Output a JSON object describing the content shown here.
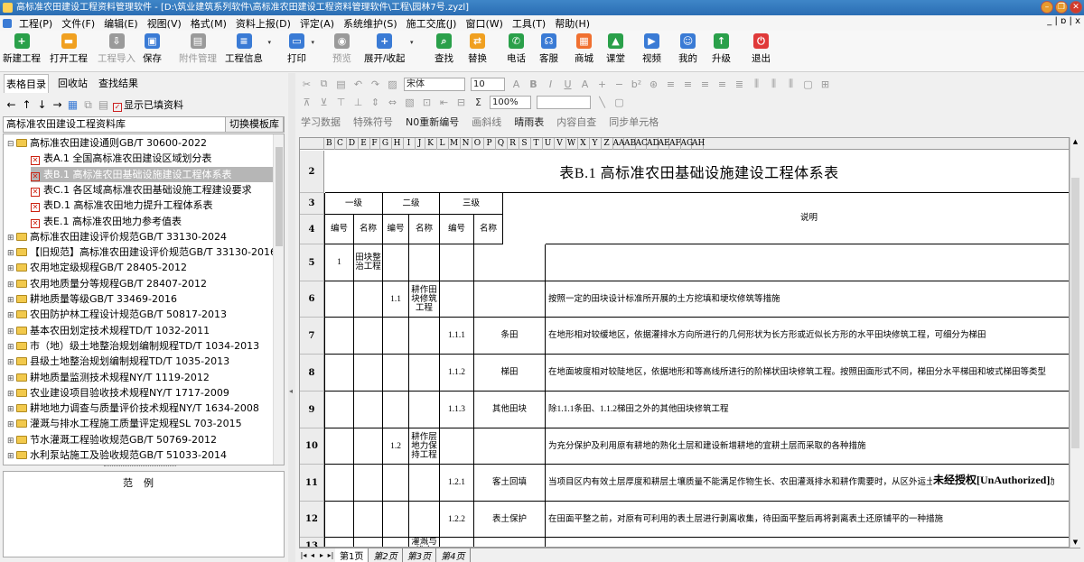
{
  "title": "高标准农田建设工程资料管理软件 - [D:\\筑业建筑系列软件\\高标准农田建设工程资料管理软件\\工程\\园林7号.zyzl]",
  "menu": [
    "工程(P)",
    "文件(F)",
    "编辑(E)",
    "视图(V)",
    "格式(M)",
    "资料上报(D)",
    "评定(A)",
    "系统维护(S)",
    "施工交底(J)",
    "窗口(W)",
    "工具(T)",
    "帮助(H)"
  ],
  "mdi_controls": "_ | ɒ | x",
  "toolbar": [
    {
      "label": "新建工程",
      "icon": "new-project-icon",
      "glyph": "+",
      "color": "#2aa04a",
      "disabled": false
    },
    {
      "label": "打开工程",
      "icon": "open-project-icon",
      "glyph": "▬",
      "color": "#f0a020",
      "disabled": false
    },
    {
      "label": "工程导入",
      "icon": "import-project-icon",
      "glyph": "⇩",
      "color": "#9a9a9a",
      "disabled": true
    },
    {
      "label": "保存",
      "icon": "save-icon",
      "glyph": "▣",
      "color": "#3a7bd5",
      "disabled": false
    },
    {
      "label": "附件管理",
      "icon": "attachment-icon",
      "glyph": "▤",
      "color": "#9a9a9a",
      "disabled": true
    },
    {
      "label": "工程信息",
      "icon": "project-info-icon",
      "glyph": "≡",
      "color": "#3a7bd5",
      "disabled": false
    },
    {
      "label": "打印",
      "icon": "print-icon",
      "glyph": "▭",
      "color": "#3a7bd5",
      "disabled": false
    },
    {
      "label": "预览",
      "icon": "preview-icon",
      "glyph": "◉",
      "color": "#9a9a9a",
      "disabled": true
    },
    {
      "label": "展开/收起",
      "icon": "expand-collapse-icon",
      "glyph": "+",
      "color": "#3a7bd5",
      "disabled": false
    },
    {
      "label": "查找",
      "icon": "find-icon",
      "glyph": "⌕",
      "color": "#2aa04a",
      "disabled": false
    },
    {
      "label": "替换",
      "icon": "replace-icon",
      "glyph": "⇄",
      "color": "#f0a020",
      "disabled": false
    },
    {
      "label": "电话",
      "icon": "phone-icon",
      "glyph": "✆",
      "color": "#2aa04a",
      "disabled": false
    },
    {
      "label": "客服",
      "icon": "customer-service-icon",
      "glyph": "☊",
      "color": "#3a7bd5",
      "disabled": false
    },
    {
      "label": "商城",
      "icon": "store-icon",
      "glyph": "▦",
      "color": "#f07030",
      "disabled": false
    },
    {
      "label": "课堂",
      "icon": "classroom-icon",
      "glyph": "▲",
      "color": "#2aa04a",
      "disabled": false
    },
    {
      "label": "视频",
      "icon": "video-icon",
      "glyph": "▶",
      "color": "#3a7bd5",
      "disabled": false
    },
    {
      "label": "我的",
      "icon": "user-icon",
      "glyph": "☺",
      "color": "#3a7bd5",
      "disabled": false
    },
    {
      "label": "升级",
      "icon": "upgrade-icon",
      "glyph": "↑",
      "color": "#2aa04a",
      "disabled": false
    },
    {
      "label": "退出",
      "icon": "exit-icon",
      "glyph": "⏻",
      "color": "#e03a3a",
      "disabled": false
    }
  ],
  "left_tabs": [
    "表格目录",
    "回收站",
    "查找结果"
  ],
  "show_filled_label": "显示已填资料",
  "library_name": "高标准农田建设工程资料库",
  "switch_template_label": "切换模板库",
  "tree": [
    {
      "label": "高标准农田建设通则GB/T 30600-2022",
      "level": 0,
      "type": "folder-open"
    },
    {
      "label": "表A.1 全国高标准农田建设区域划分表",
      "level": 1,
      "type": "table"
    },
    {
      "label": "表B.1 高标准农田基础设施建设工程体系表",
      "level": 1,
      "type": "table",
      "selected": true
    },
    {
      "label": "表C.1 各区域高标准农田基础设施工程建设要求",
      "level": 1,
      "type": "table"
    },
    {
      "label": "表D.1 高标准农田地力提升工程体系表",
      "level": 1,
      "type": "table"
    },
    {
      "label": "表E.1 高标准农田地力参考值表",
      "level": 1,
      "type": "table"
    },
    {
      "label": "高标准农田建设评价规范GB/T 33130-2024",
      "level": 0,
      "type": "folder"
    },
    {
      "label": "【旧规范】高标准农田建设评价规范GB/T 33130-2016",
      "level": 0,
      "type": "folder"
    },
    {
      "label": "农用地定级规程GB/T 28405-2012",
      "level": 0,
      "type": "folder"
    },
    {
      "label": "农用地质量分等规程GB/T 28407-2012",
      "level": 0,
      "type": "folder"
    },
    {
      "label": "耕地质量等级GB/T 33469-2016",
      "level": 0,
      "type": "folder"
    },
    {
      "label": "农田防护林工程设计规范GB/T 50817-2013",
      "level": 0,
      "type": "folder"
    },
    {
      "label": "基本农田划定技术规程TD/T 1032-2011",
      "level": 0,
      "type": "folder"
    },
    {
      "label": "市（地）级土地整治规划编制规程TD/T 1034-2013",
      "level": 0,
      "type": "folder"
    },
    {
      "label": "县级土地整治规划编制规程TD/T 1035-2013",
      "level": 0,
      "type": "folder"
    },
    {
      "label": "耕地质量监测技术规程NY/T 1119-2012",
      "level": 0,
      "type": "folder"
    },
    {
      "label": "农业建设项目验收技术规程NY/T 1717-2009",
      "level": 0,
      "type": "folder"
    },
    {
      "label": "耕地地力调查与质量评价技术规程NY/T 1634-2008",
      "level": 0,
      "type": "folder"
    },
    {
      "label": "灌溉与排水工程施工质量评定规程SL 703-2015",
      "level": 0,
      "type": "folder"
    },
    {
      "label": "节水灌溉工程验收规范GB/T 50769-2012",
      "level": 0,
      "type": "folder"
    },
    {
      "label": "水利泵站施工及验收规范GB/T 51033-2014",
      "level": 0,
      "type": "folder"
    }
  ],
  "sample_label": "范例",
  "editor": {
    "row1_note": "宋体",
    "font_name": "宋体",
    "font_size": "10",
    "zoom": "100%",
    "row3": [
      "学习数据",
      "特殊符号",
      "N0重新编号",
      "画斜线",
      "晴雨表",
      "内容自查",
      "同步单元格"
    ]
  },
  "columns": [
    "B",
    "C",
    "D",
    "E",
    "F",
    "G",
    "H",
    "I",
    "J",
    "K",
    "L",
    "M",
    "N",
    "O",
    "P",
    "Q",
    "R",
    "S",
    "T",
    "U",
    "V",
    "W",
    "X",
    "Y",
    "Z",
    "AA",
    "AB",
    "AC",
    "AD",
    "AE",
    "AF",
    "AG",
    "AH"
  ],
  "sheet": {
    "title": "表B.1 高标准农田基础设施建设工程体系表",
    "h_level1": "一级",
    "h_level2": "二级",
    "h_level3": "三级",
    "h_desc": "说明",
    "h_num": "编号",
    "h_name": "名称",
    "rows": [
      {
        "r": "5",
        "n1": "1",
        "name1": "田块整治工程",
        "n2": "",
        "name2": "",
        "n3": "",
        "name3": "",
        "desc": ""
      },
      {
        "r": "6",
        "n1": "",
        "name1": "",
        "n2": "1.1",
        "name2": "耕作田块修筑工程",
        "n3": "",
        "name3": "",
        "desc": "按照一定的田块设计标准所开展的土方挖填和埂坎修筑等措施"
      },
      {
        "r": "7",
        "n1": "",
        "name1": "",
        "n2": "",
        "name2": "",
        "n3": "1.1.1",
        "name3": "条田",
        "desc": "在地形相对较缓地区，依据灌排水方向所进行的几何形状为长方形或近似长方形的水平田块修筑工程，可细分为梯田"
      },
      {
        "r": "8",
        "n1": "",
        "name1": "",
        "n2": "",
        "name2": "",
        "n3": "1.1.2",
        "name3": "梯田",
        "desc": "在地面坡度相对较陡地区，依据地形和等高线所进行的阶梯状田块修筑工程。按照田面形式不同，梯田分水平梯田和坡式梯田等类型"
      },
      {
        "r": "9",
        "n1": "",
        "name1": "",
        "n2": "",
        "name2": "",
        "n3": "1.1.3",
        "name3": "其他田块",
        "desc": "除1.1.1条田、1.1.2梯田之外的其他田块修筑工程"
      },
      {
        "r": "10",
        "n1": "",
        "name1": "",
        "n2": "1.2",
        "name2": "耕作层地力保持工程",
        "n3": "",
        "name3": "",
        "desc": "为充分保护及利用原有耕地的熟化土层和建设新增耕地的宜耕土层而采取的各种措施"
      },
      {
        "r": "11",
        "n1": "",
        "name1": "",
        "n2": "",
        "name2": "",
        "n3": "1.2.1",
        "name3": "客土回填",
        "desc": "当项目区内有效土层厚度和耕层土壤质量不能满足作物生长、农田灌溉排水和耕作需要时，从区外运土填筑到回填部位的土方搬移活动"
      },
      {
        "r": "12",
        "n1": "",
        "name1": "",
        "n2": "",
        "name2": "",
        "n3": "1.2.2",
        "name3": "表土保护",
        "desc": "在田面平整之前，对原有可利用的表土层进行剥离收集，待田面平整后再将剥离表土还原铺平的一种措施"
      },
      {
        "r": "13",
        "n1": "",
        "name1": "",
        "n2": "",
        "name2": "灌溉与排水",
        "n3": "",
        "name3": "",
        "desc": ""
      }
    ]
  },
  "watermark": "未经授权[UnAuthorized]",
  "sheet_tabs": [
    "第1页",
    "第2页",
    "第3页",
    "第4页"
  ]
}
